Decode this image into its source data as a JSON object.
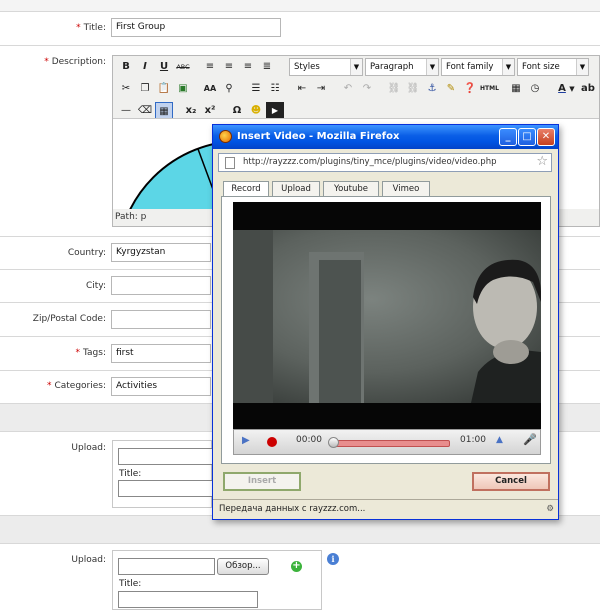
{
  "form": {
    "title": {
      "label": "Title:",
      "value": "First Group"
    },
    "description": {
      "label": "Description:"
    },
    "country": {
      "label": "Country:",
      "value": "Kyrgyzstan"
    },
    "city": {
      "label": "City:",
      "value": ""
    },
    "zip": {
      "label": "Zip/Postal Code:",
      "value": ""
    },
    "tags": {
      "label": "Tags:",
      "value": "first"
    },
    "categories": {
      "label": "Categories:",
      "value": "Activities"
    },
    "required_mark": "*"
  },
  "editor": {
    "selects": {
      "styles": "Styles",
      "paragraph": "Paragraph",
      "font_family": "Font family",
      "font_size": "Font size"
    },
    "buttons": {
      "bold": "B",
      "italic": "I",
      "underline": "U",
      "strikethrough": "ABC",
      "subscript": "x₂",
      "superscript": "x²",
      "omega": "Ω",
      "html": "HTML"
    },
    "path": "Path: p"
  },
  "uploads": [
    {
      "label": "Upload:",
      "title_label": "Title:",
      "browse": ""
    },
    {
      "label": "Upload:",
      "title_label": "Title:",
      "browse": "Обзор..."
    }
  ],
  "popup": {
    "window_title": "Insert Video - Mozilla Firefox",
    "url": "http://rayzzz.com/plugins/tiny_mce/plugins/video/video.php",
    "tabs": [
      "Record",
      "Upload",
      "Youtube",
      "Vimeo"
    ],
    "active_tab": "Record",
    "player": {
      "current_time": "00:00",
      "total_time": "01:00",
      "progress": 0
    },
    "insert_label": "Insert",
    "cancel_label": "Cancel",
    "status": "Передача данных с rayzzz.com..."
  },
  "colors": {
    "accent": "#0054e3",
    "required": "#cc0000",
    "record": "#cc0000",
    "circle_fill": "#5cd6e6"
  }
}
